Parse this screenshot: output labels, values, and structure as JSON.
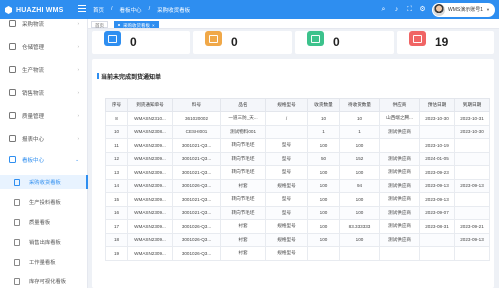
{
  "header": {
    "brand": "HUAZHI WMS",
    "crumbs": [
      "首页",
      "看板中心",
      "采购收货看板"
    ],
    "user_name": "WMS演示账号1",
    "colors": {
      "primary": "#2e8ef0"
    }
  },
  "sidebar": {
    "items": [
      {
        "label": "采购物流",
        "icon": "truck-icon"
      },
      {
        "label": "仓储管理",
        "icon": "warehouse-icon"
      },
      {
        "label": "生产物流",
        "icon": "factory-icon"
      },
      {
        "label": "销售物流",
        "icon": "cart-icon"
      },
      {
        "label": "质量管理",
        "icon": "quality-icon"
      },
      {
        "label": "报表中心",
        "icon": "report-icon"
      },
      {
        "label": "看板中心",
        "icon": "dashboard-icon"
      }
    ],
    "sub_items": [
      {
        "label": "采购收货看板"
      },
      {
        "label": "生产投料看板"
      },
      {
        "label": "质量看板"
      },
      {
        "label": "销售出库看板"
      },
      {
        "label": "工作量看板"
      },
      {
        "label": "库存可视化看板"
      }
    ]
  },
  "tabs": [
    {
      "label": "首页"
    },
    {
      "label": "采购收货看板"
    }
  ],
  "stats": [
    {
      "value": "0",
      "color": "#2e8ef0"
    },
    {
      "value": "0",
      "color": "#f0a848"
    },
    {
      "value": "0",
      "color": "#3cc28c"
    },
    {
      "value": "19",
      "color": "#f06464"
    }
  ],
  "panel": {
    "title": "当前未完成到货通知单",
    "columns": [
      "序号",
      "到货通知单号",
      "料号",
      "品名",
      "规格型号",
      "收货数量",
      "待收货数量",
      "供应商",
      "预估日期",
      "到期日期"
    ],
    "rows": [
      [
        "8",
        "WMASN2310...",
        "361020002",
        "一道三防_天...",
        "/",
        "10",
        "10",
        "山西端之腾...",
        "2023-10-30",
        "2023-10-31"
      ],
      [
        "10",
        "WMASN2308...",
        "CESHI001",
        "测试物料001",
        "",
        "1",
        "1",
        "测试供应商",
        "",
        "2023-10-30"
      ],
      [
        "11",
        "WMASN2309...",
        "3001021-Q3...",
        "转向节毛坯",
        "型号",
        "100",
        "100",
        "",
        "2023-10-19",
        ""
      ],
      [
        "12",
        "WMASN2309...",
        "3001021-Q3...",
        "转向节毛坯",
        "型号",
        "50",
        "152",
        "测试供应商",
        "2024-01-05",
        ""
      ],
      [
        "13",
        "WMASN2309...",
        "3001021-Q3...",
        "转向节毛坯",
        "型号",
        "100",
        "100",
        "测试供应商",
        "2023-09-23",
        ""
      ],
      [
        "14",
        "WMASN2309...",
        "3001026-Q3...",
        "衬套",
        "规格型号",
        "100",
        "94",
        "测试供应商",
        "2023-09-13",
        "2023-09-13"
      ],
      [
        "15",
        "WMASN2309...",
        "3001021-Q3...",
        "转向节毛坯",
        "型号",
        "100",
        "100",
        "测试供应商",
        "2023-09-13",
        ""
      ],
      [
        "16",
        "WMASN2309...",
        "3001021-Q3...",
        "转向节毛坯",
        "型号",
        "100",
        "100",
        "测试供应商",
        "2023-09-07",
        ""
      ],
      [
        "17",
        "WMASN2309...",
        "3001026-Q3...",
        "衬套",
        "规格型号",
        "100",
        "83.333333",
        "测试供应商",
        "2023-08-31",
        "2023-09-21"
      ],
      [
        "18",
        "WMASN2309...",
        "3001026-Q3...",
        "衬套",
        "规格型号",
        "100",
        "100",
        "测试供应商",
        "",
        "2023-09-13"
      ],
      [
        "19",
        "WMASN2309...",
        "3001026-Q3...",
        "衬套",
        "规格型号",
        "",
        "",
        "",
        "",
        ""
      ]
    ]
  }
}
